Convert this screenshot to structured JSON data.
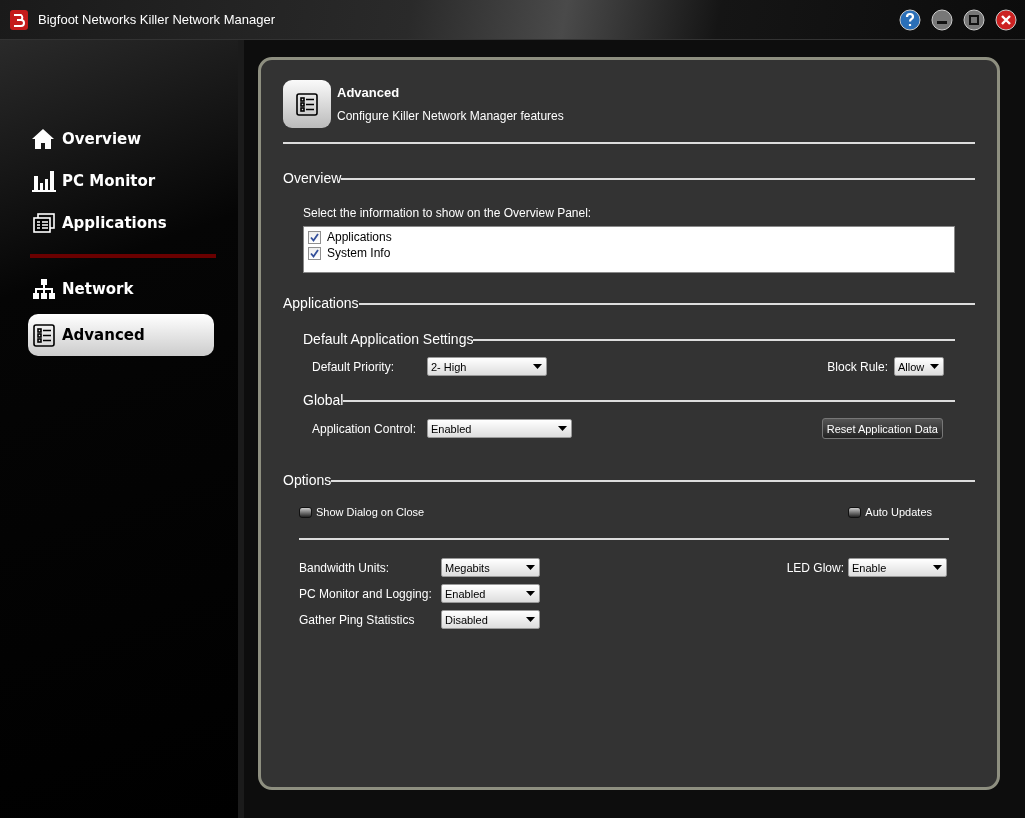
{
  "window": {
    "title": "Bigfoot Networks Killer Network Manager"
  },
  "sidebar": {
    "groups": [
      {
        "items": [
          {
            "label": "Overview",
            "selected": false
          },
          {
            "label": "PC Monitor",
            "selected": false
          },
          {
            "label": "Applications",
            "selected": false
          }
        ]
      },
      {
        "items": [
          {
            "label": "Network",
            "selected": false
          },
          {
            "label": "Advanced",
            "selected": true
          }
        ]
      }
    ]
  },
  "header": {
    "title": "Advanced",
    "subtitle": "Configure Killer Network Manager features"
  },
  "overview": {
    "heading": "Overview",
    "prompt": "Select the information to show on the Overview Panel:",
    "items": [
      {
        "label": "Applications",
        "checked": true
      },
      {
        "label": "System Info",
        "checked": true
      }
    ]
  },
  "applications": {
    "heading": "Applications",
    "default_settings": {
      "heading": "Default Application Settings",
      "priority": {
        "label": "Default Priority:",
        "value": "2- High"
      },
      "block_rule": {
        "label": "Block Rule:",
        "value": "Allow"
      }
    },
    "global": {
      "heading": "Global",
      "control": {
        "label": "Application Control:",
        "value": "Enabled"
      },
      "reset_button": "Reset Application Data"
    }
  },
  "options": {
    "heading": "Options",
    "toggles": [
      {
        "label": "Show Dialog on Close",
        "checked": false
      },
      {
        "label": "Auto Updates",
        "checked": false
      }
    ],
    "selects": [
      {
        "label": "Bandwidth Units:",
        "value": "Megabits"
      },
      {
        "label": "PC Monitor and Logging:",
        "value": "Enabled"
      },
      {
        "label": "Gather Ping Statistics",
        "value": "Disabled"
      }
    ],
    "led_glow": {
      "label": "LED Glow:",
      "value": "Enable"
    }
  }
}
